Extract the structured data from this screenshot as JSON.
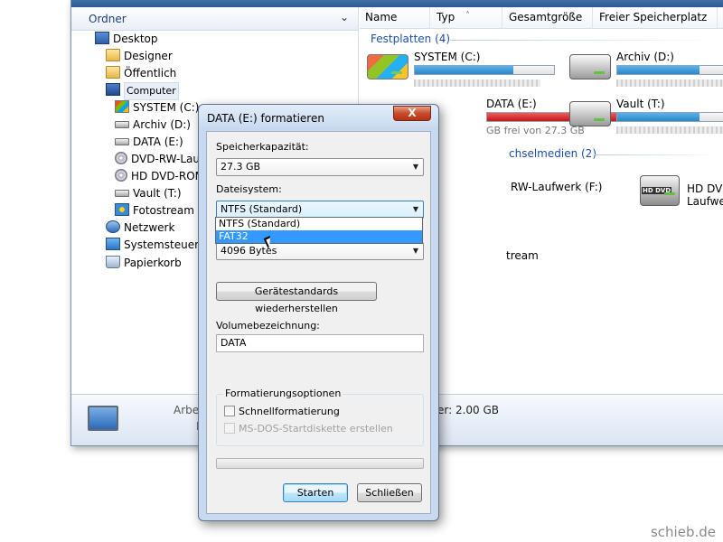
{
  "nav": {
    "header": "Ordner",
    "items": [
      {
        "label": "Desktop",
        "icon": "desktop-icon"
      },
      {
        "label": "Designer",
        "icon": "folder-icon"
      },
      {
        "label": "Öffentlich",
        "icon": "folder-icon"
      },
      {
        "label": "Computer",
        "icon": "computer-icon"
      },
      {
        "label": "SYSTEM (C:)",
        "icon": "windows-drive-icon"
      },
      {
        "label": "Archiv (D:)",
        "icon": "drive-icon"
      },
      {
        "label": "DATA (E:)",
        "icon": "drive-icon"
      },
      {
        "label": "DVD-RW-Lauf",
        "icon": "disc-drive-icon"
      },
      {
        "label": "HD DVD-ROM",
        "icon": "disc-drive-icon"
      },
      {
        "label": "Vault (T:)",
        "icon": "drive-icon"
      },
      {
        "label": "Fotostream",
        "icon": "photo-stream-icon"
      },
      {
        "label": "Netzwerk",
        "icon": "network-icon"
      },
      {
        "label": "Systemsteuerun",
        "icon": "control-panel-icon"
      },
      {
        "label": "Papierkorb",
        "icon": "recycle-bin-icon"
      }
    ]
  },
  "columns": [
    "Name",
    "Typ",
    "Gesamtgröße",
    "Freier Speicherplatz"
  ],
  "groups": {
    "hdd": "Festplatten (4)",
    "removable": "chselmedien (2)"
  },
  "drives": {
    "c": {
      "name": "SYSTEM (C:)",
      "fill": 0.71
    },
    "d": {
      "name": "Archiv (D:)",
      "fill": 0.59
    },
    "e": {
      "name": "DATA (E:)",
      "free_text": "GB frei von 27.3 GB",
      "fill": 0.96
    },
    "t": {
      "name": "Vault (T:)",
      "fill": 0.59
    },
    "f": {
      "name": "RW-Laufwerk (F:)"
    },
    "hd": {
      "name": "HD DVD-ROM-Laufwe",
      "badge": "HD DVD"
    },
    "stream": {
      "name": "tream"
    }
  },
  "details": {
    "left_partial": "Arbe",
    "left_partial2": "F",
    "size_text": "er: 2.00 GB"
  },
  "dialog": {
    "title": "DATA (E:) formatieren",
    "close_label": "X",
    "capacity_label": "Speicherkapazität:",
    "capacity_value": "27.3 GB",
    "filesystem_label": "Dateisystem:",
    "filesystem_value": "NTFS (Standard)",
    "filesystem_options": [
      "NTFS (Standard)",
      "FAT32"
    ],
    "cluster_value": "4096 Bytes",
    "restore_button": "Gerätestandards wiederherstellen",
    "volume_label": "Volumebezeichnung:",
    "volume_value": "DATA",
    "options_title": "Formatierungsoptionen",
    "quick_format": "Schnellformatierung",
    "msdos_disk": "MS-DOS-Startdiskette erstellen",
    "progress": 0,
    "start_button": "Starten",
    "close_button": "Schließen"
  },
  "watermark": "schieb.de"
}
